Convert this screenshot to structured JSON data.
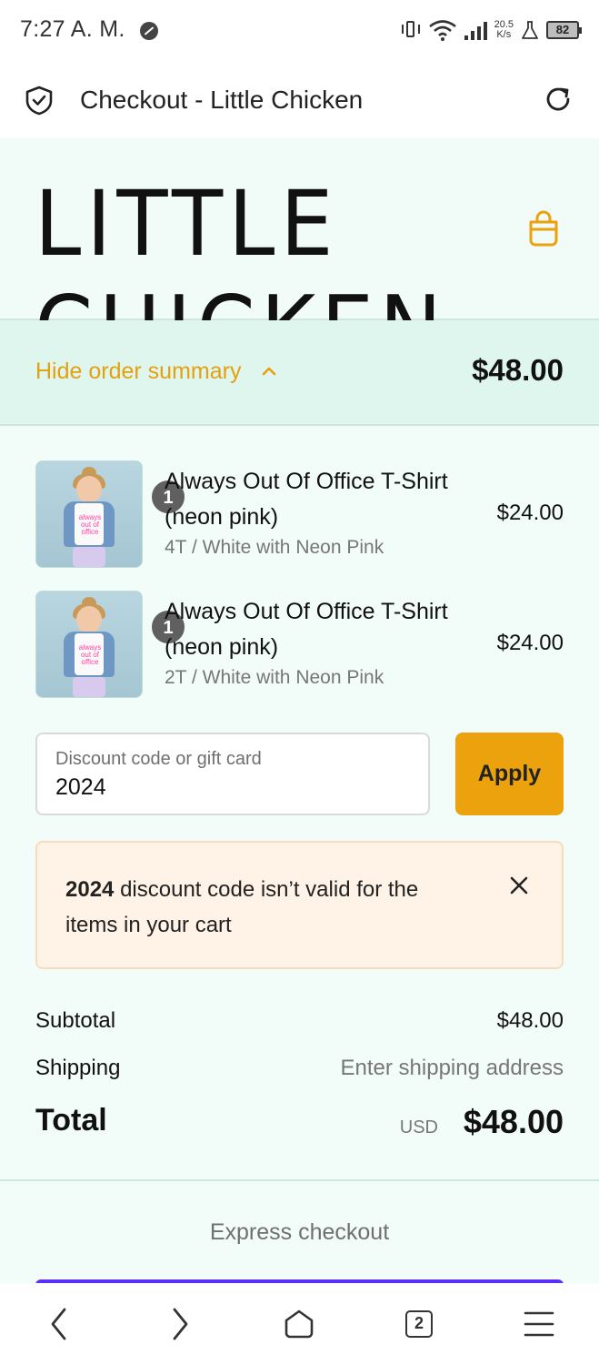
{
  "status_bar": {
    "time": "7:27 A. M.",
    "net_speed_value": "20.5",
    "net_speed_unit": "K/s",
    "battery": "82"
  },
  "browser": {
    "title": "Checkout - Little Chicken",
    "tabs_count": "2"
  },
  "store": {
    "name": "LITTLE CHICKEN",
    "accent_color": "#eba20d"
  },
  "summary_toggle": {
    "label": "Hide order summary",
    "total": "$48.00"
  },
  "line_items": [
    {
      "quantity": "1",
      "title": "Always Out Of Office T-Shirt (neon pink)",
      "variant": "4T / White with Neon Pink",
      "price": "$24.00",
      "shirt_text": "always out of office"
    },
    {
      "quantity": "1",
      "title": "Always Out Of Office T-Shirt (neon pink)",
      "variant": "2T / White with Neon Pink",
      "price": "$24.00",
      "shirt_text": "always out of office"
    }
  ],
  "discount": {
    "placeholder": "Discount code or gift card",
    "value": "2024",
    "apply_label": "Apply"
  },
  "error": {
    "code": "2024",
    "message": "discount code isn’t valid for the items in your cart"
  },
  "totals": {
    "subtotal_label": "Subtotal",
    "subtotal_value": "$48.00",
    "shipping_label": "Shipping",
    "shipping_value": "Enter shipping address",
    "total_label": "Total",
    "currency": "USD",
    "total_value": "$48.00"
  },
  "express": {
    "label": "Express checkout",
    "button_color": "#5a31f4"
  }
}
